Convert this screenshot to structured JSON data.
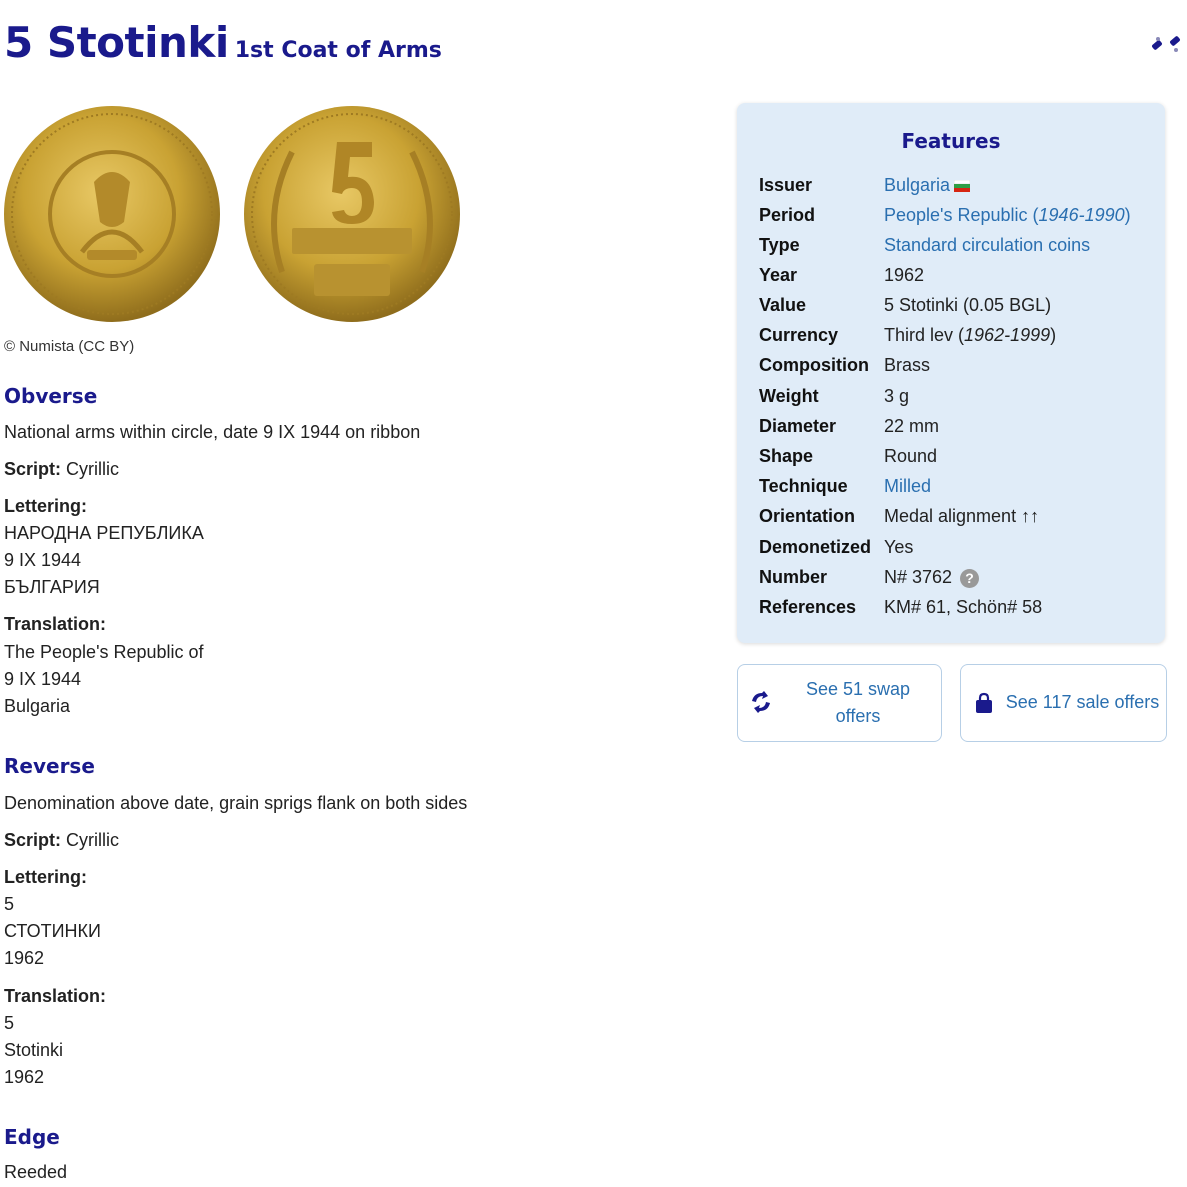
{
  "header": {
    "title": "5 Stotinki",
    "subtitle": "1st Coat of Arms"
  },
  "coins": {
    "obverse_image": "obverse-coin",
    "reverse_image": "reverse-coin"
  },
  "credit": "© Numista (CC BY)",
  "obverse": {
    "heading": "Obverse",
    "description": "National arms within circle, date 9 IX 1944 on ribbon",
    "script_label": "Script:",
    "script_value": "Cyrillic",
    "lettering_label": "Lettering:",
    "lettering": [
      "НАРОДНА РЕПУБЛИКА",
      "9 IX 1944",
      "БЪЛГАРИЯ"
    ],
    "translation_label": "Translation:",
    "translation": [
      "The People's Republic of",
      "9 IX 1944",
      "Bulgaria"
    ]
  },
  "reverse": {
    "heading": "Reverse",
    "description": "Denomination above date, grain sprigs flank on both sides",
    "script_label": "Script:",
    "script_value": "Cyrillic",
    "lettering_label": "Lettering:",
    "lettering": [
      "5",
      "СТОТИНКИ",
      "1962"
    ],
    "translation_label": "Translation:",
    "translation": [
      "5",
      "Stotinki",
      "1962"
    ]
  },
  "edge": {
    "heading": "Edge",
    "value": "Reeded"
  },
  "features": {
    "heading": "Features",
    "rows": [
      {
        "key": "Issuer",
        "value": "Bulgaria"
      },
      {
        "key": "Period",
        "value": "People's Republic",
        "value_italic": "1946-1990"
      },
      {
        "key": "Type",
        "value": "Standard circulation coins"
      },
      {
        "key": "Year",
        "value": "1962"
      },
      {
        "key": "Value",
        "value": "5 Stotinki (0.05 BGL)"
      },
      {
        "key": "Currency",
        "value": "Third lev",
        "value_italic": "1962-1999"
      },
      {
        "key": "Composition",
        "value": "Brass"
      },
      {
        "key": "Weight",
        "value": "3 g"
      },
      {
        "key": "Diameter",
        "value": "22 mm"
      },
      {
        "key": "Shape",
        "value": "Round"
      },
      {
        "key": "Technique",
        "value": "Milled"
      },
      {
        "key": "Orientation",
        "value": "Medal alignment ↑↑"
      },
      {
        "key": "Demonetized",
        "value": "Yes"
      },
      {
        "key": "Number",
        "value": "N# 3762"
      },
      {
        "key": "References",
        "value": "KM# 61, Schön# 58"
      }
    ]
  },
  "buttons": {
    "swap_line1": "See 51 swap",
    "swap_line2": "offers",
    "sale": "See 117 sale offers"
  },
  "colors": {
    "heading": "#1a1a8c",
    "link": "#2a6fb0",
    "panel": "#e0ecf8",
    "coin": "#c9a233"
  }
}
